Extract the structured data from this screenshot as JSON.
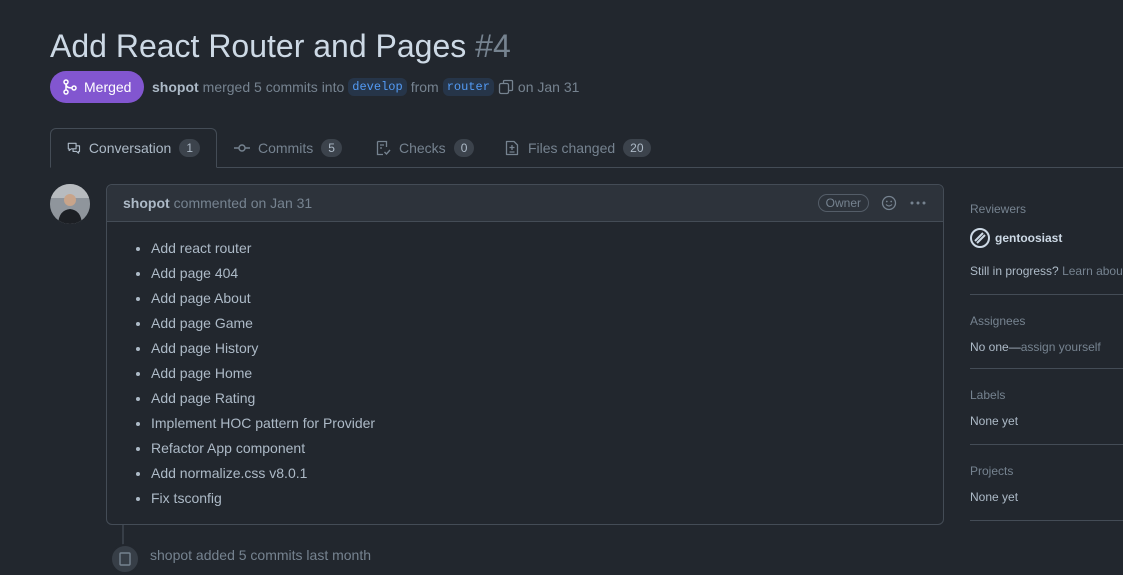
{
  "pr": {
    "title": "Add React Router and Pages",
    "number": "#4"
  },
  "status": {
    "badge": "Merged",
    "author": "shopot",
    "merged_text": "merged 5 commits into",
    "base_branch": "develop",
    "from_text": "from",
    "head_branch": "router",
    "date_text": "on Jan 31"
  },
  "tabs": [
    {
      "label": "Conversation",
      "count": "1",
      "icon": "comment-discussion-icon"
    },
    {
      "label": "Commits",
      "count": "5",
      "icon": "git-commit-icon"
    },
    {
      "label": "Checks",
      "count": "0",
      "icon": "checklist-icon"
    },
    {
      "label": "Files changed",
      "count": "20",
      "icon": "file-diff-icon"
    }
  ],
  "comment": {
    "author": "shopot",
    "meta": "commented on Jan 31",
    "role": "Owner",
    "items": [
      "Add react router",
      "Add page 404",
      "Add page About",
      "Add page Game",
      "Add page History",
      "Add page Home",
      "Add page Rating",
      "Implement HOC pattern for Provider",
      "Refactor App component",
      "Add normalize.css v8.0.1",
      "Fix tsconfig"
    ]
  },
  "sidebar": {
    "reviewers": {
      "heading": "Reviewers",
      "name": "gentoosiast",
      "progress": "Still in progress?",
      "learn": "Learn about"
    },
    "assignees": {
      "heading": "Assignees",
      "value": "No one—",
      "action": "assign yourself"
    },
    "labels": {
      "heading": "Labels",
      "value": "None yet"
    },
    "projects": {
      "heading": "Projects",
      "value": "None yet"
    }
  },
  "timeline": {
    "text": "shopot added 5 commits last month"
  },
  "colors": {
    "merged": "#8256d0",
    "link": "#539bf5",
    "background": "#22272e"
  }
}
